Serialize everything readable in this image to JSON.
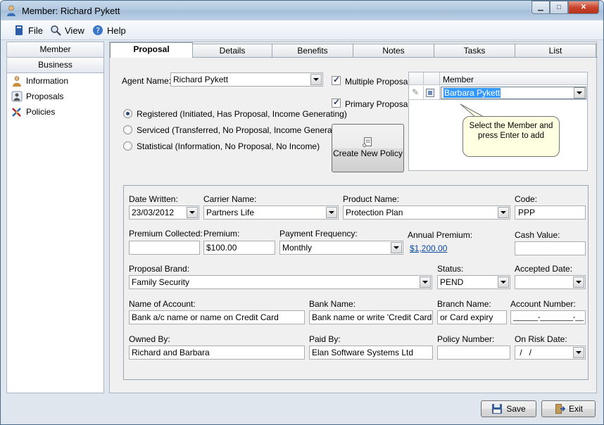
{
  "window": {
    "title": "Member: Richard Pykett"
  },
  "menu": [
    {
      "label": "File"
    },
    {
      "label": "View"
    },
    {
      "label": "Help"
    }
  ],
  "left": {
    "tabs": [
      "Member",
      "Business"
    ],
    "items": [
      {
        "label": "Information"
      },
      {
        "label": "Proposals"
      },
      {
        "label": "Policies"
      }
    ]
  },
  "tabs": [
    "Proposal",
    "Details",
    "Benefits",
    "Notes",
    "Tasks",
    "List"
  ],
  "proposal": {
    "agent_label": "Agent Name:",
    "agent_value": "Richard Pykett",
    "multiple_label": "Multiple Proposal",
    "primary_label": "Primary Proposal",
    "radios": [
      "Registered (Initiated, Has Proposal, Income Generating)",
      "Serviced (Transferred, No Proposal, Income Generating)",
      "Statistical (Information, No Proposal, No Income)"
    ],
    "create_policy_label": "Create New Policy",
    "grid_header": "Member",
    "grid_member": "Barbara Pykett",
    "tooltip": "Select the Member and press Enter to add"
  },
  "form": {
    "date_written_label": "Date Written:",
    "date_written": "23/03/2012",
    "carrier_label": "Carrier Name:",
    "carrier": "Partners Life",
    "product_label": "Product Name:",
    "product": "Protection Plan",
    "code_label": "Code:",
    "code": "PPP",
    "premium_collected_label": "Premium Collected:",
    "premium_collected": "",
    "premium_label": "Premium:",
    "premium": "$100.00",
    "payment_freq_label": "Payment Frequency:",
    "payment_freq": "Monthly",
    "annual_label": "Annual Premium:",
    "annual": "$1,200.00",
    "cash_label": "Cash Value:",
    "cash": "",
    "brand_label": "Proposal Brand:",
    "brand": "Family Security",
    "status_label": "Status:",
    "status": "PEND",
    "accepted_label": "Accepted Date:",
    "accepted": " /   /",
    "account_name_label": "Name of Account:",
    "account_name": "Bank a/c name or name on Credit Card",
    "bank_label": "Bank Name:",
    "bank": "Bank name or write 'Credit Card'",
    "branch_label": "Branch Name:",
    "branch": "or Card expiry",
    "account_number_label": "Account Number:",
    "account_number": "______-________-__",
    "owned_label": "Owned By:",
    "owned": "Richard and Barbara",
    "paid_label": "Paid By:",
    "paid": "Elan Software Systems Ltd",
    "policy_label": "Policy Number:",
    "policy": "",
    "onrisk_label": "On Risk Date:",
    "onrisk": " /   /"
  },
  "buttons": {
    "save": "Save",
    "exit": "Exit"
  }
}
